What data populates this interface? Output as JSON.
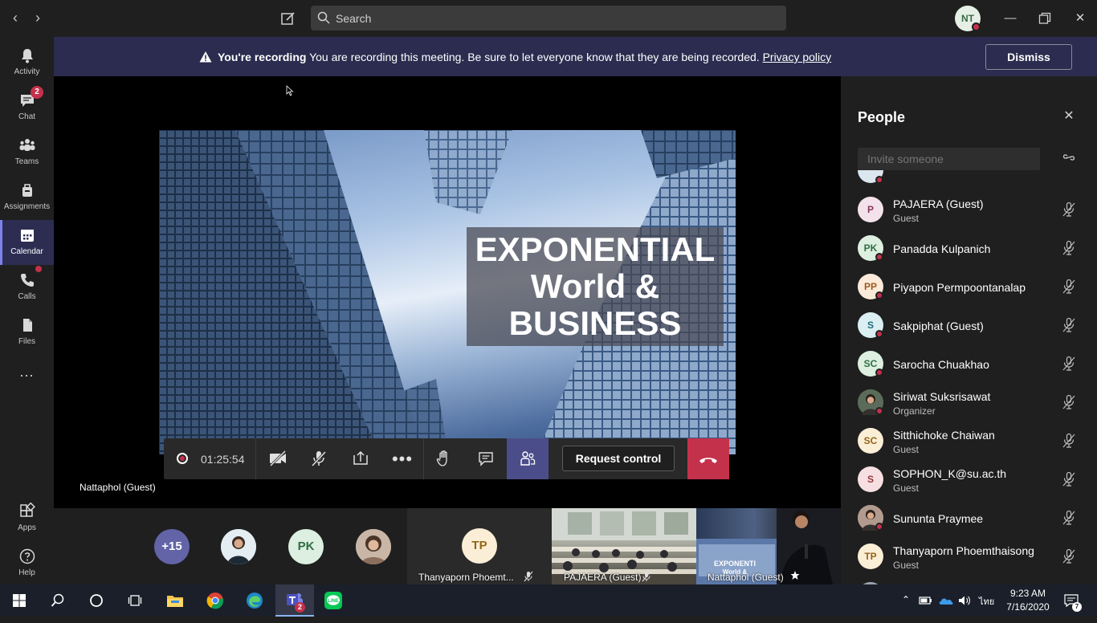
{
  "search": {
    "placeholder": "Search"
  },
  "me": {
    "initials": "NT"
  },
  "rail": {
    "items": [
      {
        "label": "Activity",
        "icon": "bell-icon"
      },
      {
        "label": "Chat",
        "icon": "chat-icon",
        "badge": "2"
      },
      {
        "label": "Teams",
        "icon": "teams-icon"
      },
      {
        "label": "Assignments",
        "icon": "assignments-icon"
      },
      {
        "label": "Calendar",
        "icon": "calendar-icon",
        "active": true
      },
      {
        "label": "Calls",
        "icon": "phone-icon"
      },
      {
        "label": "Files",
        "icon": "files-icon"
      }
    ],
    "more": "...",
    "bottom": [
      {
        "label": "Apps",
        "icon": "apps-icon"
      },
      {
        "label": "Help",
        "icon": "help-icon"
      }
    ]
  },
  "banner": {
    "bold": "You're recording",
    "message": "You are recording this meeting. Be sure to let everyone know that they are being recorded.",
    "link": "Privacy policy",
    "dismiss": "Dismiss"
  },
  "slide": {
    "line1": "EXPONENTIAL",
    "line2": "World &",
    "line3": "BUSINESS"
  },
  "controls": {
    "timer": "01:25:54",
    "request_control": "Request control"
  },
  "presenter": {
    "label": "Nattaphol (Guest)"
  },
  "strip": {
    "overflow": "+15",
    "pk": "PK",
    "tiles": [
      {
        "initials": "TP",
        "label": "Thanyaporn Phoemt..."
      },
      {
        "label": "PAJAERA (Guest)"
      },
      {
        "label": "Nattaphol (Guest)"
      }
    ]
  },
  "panel": {
    "title": "People",
    "invite_placeholder": "Invite someone",
    "people": [
      {
        "initials": "P",
        "name": "PAJAERA (Guest)",
        "role": "Guest",
        "bg": "#f3e2ea",
        "fg": "#8a3a5f",
        "dot": false
      },
      {
        "initials": "PK",
        "name": "Panadda Kulpanich",
        "role": "",
        "bg": "#dcefe0",
        "fg": "#2f6e43",
        "dot": true
      },
      {
        "initials": "PP",
        "name": "Piyapon Permpoontanalap",
        "role": "",
        "bg": "#fbead9",
        "fg": "#9a5a23",
        "dot": true
      },
      {
        "initials": "S",
        "name": "Sakpiphat (Guest)",
        "role": "",
        "bg": "#dbeff3",
        "fg": "#21697a",
        "dot": true
      },
      {
        "initials": "SC",
        "name": "Sarocha Chuakhao",
        "role": "",
        "bg": "#dcefe0",
        "fg": "#2f6e43",
        "dot": true
      },
      {
        "initials": "",
        "name": "Siriwat Suksrisawat",
        "role": "Organizer",
        "bg": "#5b6b5a",
        "fg": "#fff",
        "dot": true,
        "photo": true
      },
      {
        "initials": "SC",
        "name": "Sitthichoke Chaiwan",
        "role": "Guest",
        "bg": "#fbeed6",
        "fg": "#93651a",
        "dot": false
      },
      {
        "initials": "S",
        "name": "SOPHON_K@su.ac.th",
        "role": "Guest",
        "bg": "#f6dfe1",
        "fg": "#9a3440",
        "dot": false
      },
      {
        "initials": "",
        "name": "Sununta Praymee",
        "role": "",
        "bg": "#b29a8e",
        "fg": "#fff",
        "dot": true,
        "photo": true
      },
      {
        "initials": "TP",
        "name": "Thanyaporn Phoemthaisong",
        "role": "Guest",
        "bg": "#fbeed6",
        "fg": "#93651a",
        "dot": false
      }
    ]
  },
  "taskbar": {
    "time": "9:23 AM",
    "date": "7/16/2020",
    "lang": "ไทย",
    "teams_badge": "2"
  }
}
